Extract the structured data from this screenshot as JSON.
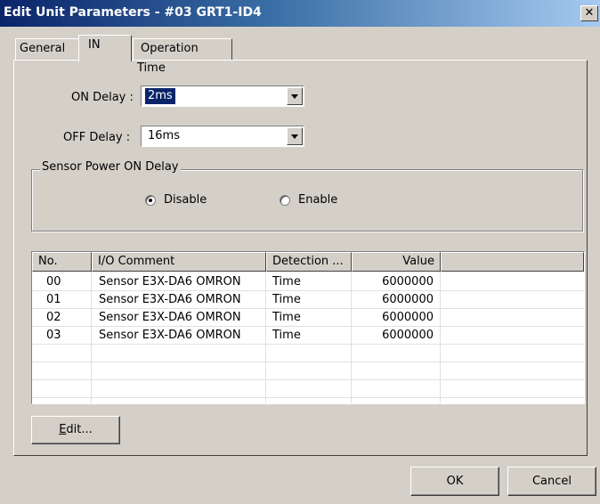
{
  "window": {
    "title": "Edit Unit Parameters - #03 GRT1-ID4",
    "close_glyph": "✕"
  },
  "tabs": [
    {
      "label": "General",
      "active": false
    },
    {
      "label": "IN",
      "active": true
    },
    {
      "label": "Operation Time",
      "active": false
    }
  ],
  "on_delay": {
    "label": "ON Delay :",
    "value": "2ms"
  },
  "off_delay": {
    "label": "OFF Delay :",
    "value": "16ms"
  },
  "sensor_power": {
    "group_label": "Sensor Power ON Delay",
    "options": [
      {
        "label": "Disable",
        "selected": true
      },
      {
        "label": "Enable",
        "selected": false
      }
    ]
  },
  "table": {
    "columns": [
      "No.",
      "I/O Comment",
      "Detection ...",
      "Value",
      ""
    ],
    "rows": [
      {
        "no": "00",
        "comment": "Sensor E3X-DA6 OMRON",
        "detection": "Time",
        "value": "6000000"
      },
      {
        "no": "01",
        "comment": "Sensor E3X-DA6 OMRON",
        "detection": "Time",
        "value": "6000000"
      },
      {
        "no": "02",
        "comment": "Sensor E3X-DA6 OMRON",
        "detection": "Time",
        "value": "6000000"
      },
      {
        "no": "03",
        "comment": "Sensor E3X-DA6 OMRON",
        "detection": "Time",
        "value": "6000000"
      }
    ]
  },
  "buttons": {
    "edit_mnemonic": "E",
    "edit_rest": "dit...",
    "ok": "OK",
    "cancel": "Cancel"
  },
  "colors": {
    "titlebar_start": "#0a246a",
    "titlebar_end": "#a6caf0",
    "face": "#d4d0c8",
    "selection": "#0a246a"
  }
}
